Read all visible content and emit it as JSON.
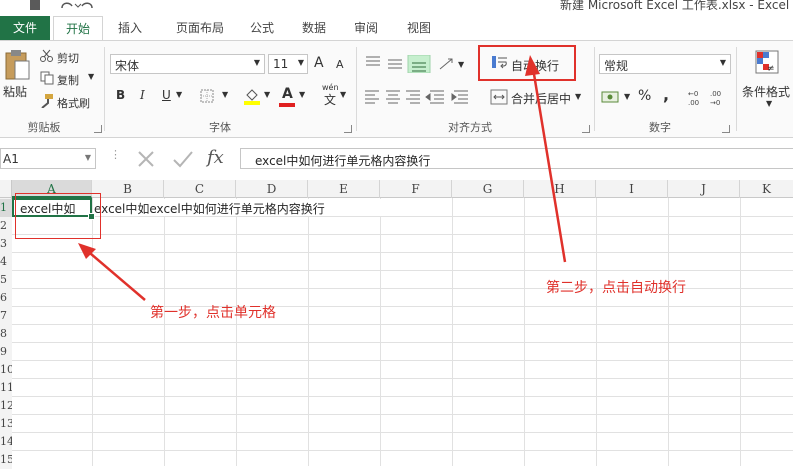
{
  "window": {
    "title": "新建 Microsoft Excel 工作表.xlsx - Excel"
  },
  "tabs": [
    "文件",
    "开始",
    "插入",
    "页面布局",
    "公式",
    "数据",
    "审阅",
    "视图"
  ],
  "clipboard": {
    "paste": "粘贴",
    "cut": "剪切",
    "copy": "复制",
    "format_painter": "格式刷",
    "label": "剪贴板"
  },
  "font": {
    "name": "宋体",
    "size": "11",
    "bold": "B",
    "italic": "I",
    "underline": "U",
    "grow": "A",
    "shrink": "A",
    "wen": "wén",
    "wen_char": "文",
    "label": "字体",
    "fill_color": "#ffff00",
    "font_color": "#e02020"
  },
  "alignment": {
    "wrap_text": "自动换行",
    "merge_center": "合并后居中",
    "label": "对齐方式"
  },
  "number": {
    "format": "常规",
    "percent": "%",
    "comma": ",",
    "label": "数字"
  },
  "styles": {
    "conditional": "条件格式"
  },
  "formula_bar": {
    "name_box": "A1",
    "fx": "fx",
    "content": "excel中如何进行单元格内容换行"
  },
  "columns": [
    "A",
    "B",
    "C",
    "D",
    "E",
    "F",
    "G",
    "H",
    "I",
    "J",
    "K"
  ],
  "rows": [
    "1",
    "2",
    "3",
    "4",
    "5",
    "6",
    "7",
    "8",
    "9",
    "10",
    "11",
    "12",
    "13",
    "14",
    "15"
  ],
  "cells": {
    "A1_visible": "excel中如",
    "overflow": "excel中如excel中如何进行单元格内容换行"
  },
  "annotations": {
    "step1": "第一步，点击单元格",
    "step2": "第二步，点击自动换行"
  },
  "colors": {
    "excel_green": "#217346",
    "annotation_red": "#e0312b"
  }
}
